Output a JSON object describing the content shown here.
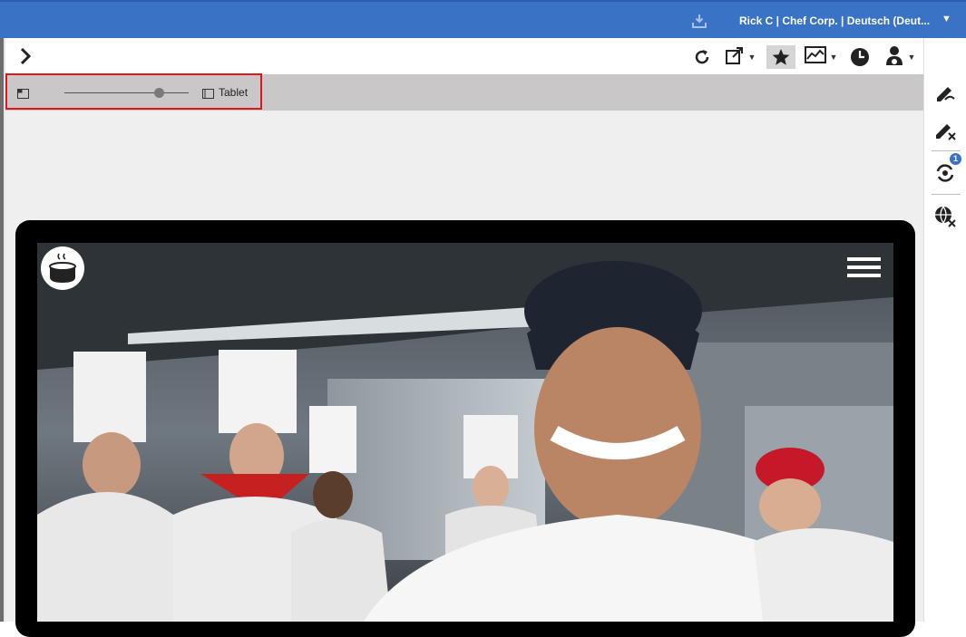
{
  "topbar": {
    "user_info": "Rick C | Chef Corp. | Deutsch (Deut...",
    "download_icon": "download-tray-icon",
    "caret_icon": "caret-down-icon"
  },
  "toolbar": {
    "expand_icon": "chevron-right-icon",
    "refresh_icon": "refresh-icon",
    "open_external_icon": "open-external-icon",
    "favorite_icon": "star-icon",
    "analytics_icon": "line-chart-icon",
    "history_icon": "clock-icon",
    "user_icon": "user-settings-icon"
  },
  "preview": {
    "layout_icon": "window-layout-icon",
    "slider_value": 0.76,
    "device_icon": "tablet-icon",
    "device_label": "Tablet"
  },
  "rail": {
    "edit_icon": "pencil-edit-icon",
    "cancel_edit_icon": "pencil-cancel-icon",
    "sync_icon": "sync-icon",
    "sync_badge": "1",
    "globe_cancel_icon": "globe-cancel-icon"
  },
  "site": {
    "logo_icon": "cooking-pot-logo",
    "menu_icon": "hamburger-menu-icon"
  },
  "colors": {
    "topbar": "#3a73c6",
    "highlight": "#e0161b",
    "preview_bar": "#c9c7c8",
    "canvas": "#efefef"
  }
}
